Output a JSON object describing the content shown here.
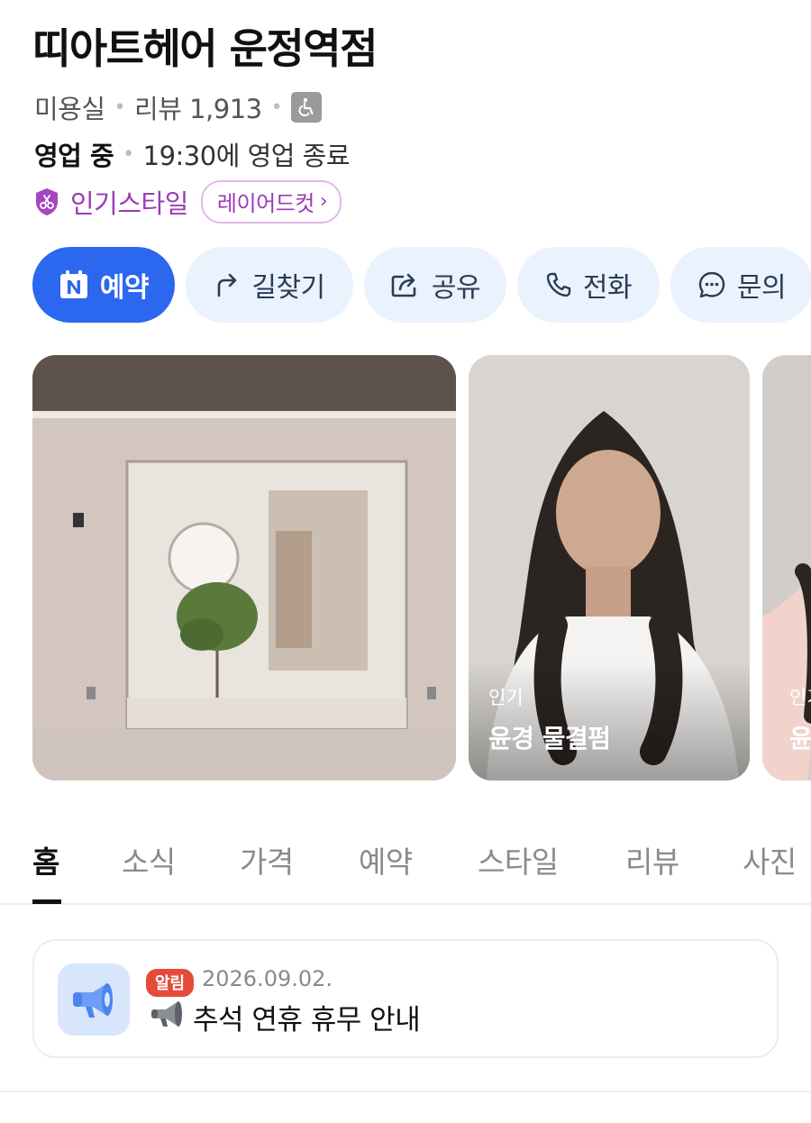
{
  "place": {
    "name": "띠아트헤어 운정역점",
    "category": "미용실",
    "review_label": "리뷰 1,913",
    "open_status": "영업 중",
    "hours_text": "19:30에 영업 종료",
    "popular_style_label": "인기스타일",
    "popular_style_chip": "레이어드컷"
  },
  "actions": [
    {
      "label": "예약",
      "icon": "naver-booking-icon"
    },
    {
      "label": "길찾기",
      "icon": "directions-arrow-icon"
    },
    {
      "label": "공유",
      "icon": "share-icon"
    },
    {
      "label": "전화",
      "icon": "phone-icon"
    },
    {
      "label": "문의",
      "icon": "chat-bubble-icon"
    }
  ],
  "gallery": {
    "items": [
      {
        "kind": "store-photo",
        "tag": "",
        "caption": ""
      },
      {
        "kind": "style-photo",
        "tag": "인기",
        "caption": "윤경 물결펌"
      },
      {
        "kind": "style-photo",
        "tag": "인기",
        "caption": "윤"
      }
    ]
  },
  "tabs": [
    "홈",
    "소식",
    "가격",
    "예약",
    "스타일",
    "리뷰",
    "사진"
  ],
  "active_tab": "홈",
  "notice": {
    "badge": "알림",
    "date": "2026.09.02.",
    "title": "추석 연휴 휴무 안내"
  },
  "colors": {
    "primary": "#2c67f0",
    "action_bg": "#eaf2fd",
    "style_accent": "#9b3bb5",
    "badge_red": "#e64a3a"
  }
}
